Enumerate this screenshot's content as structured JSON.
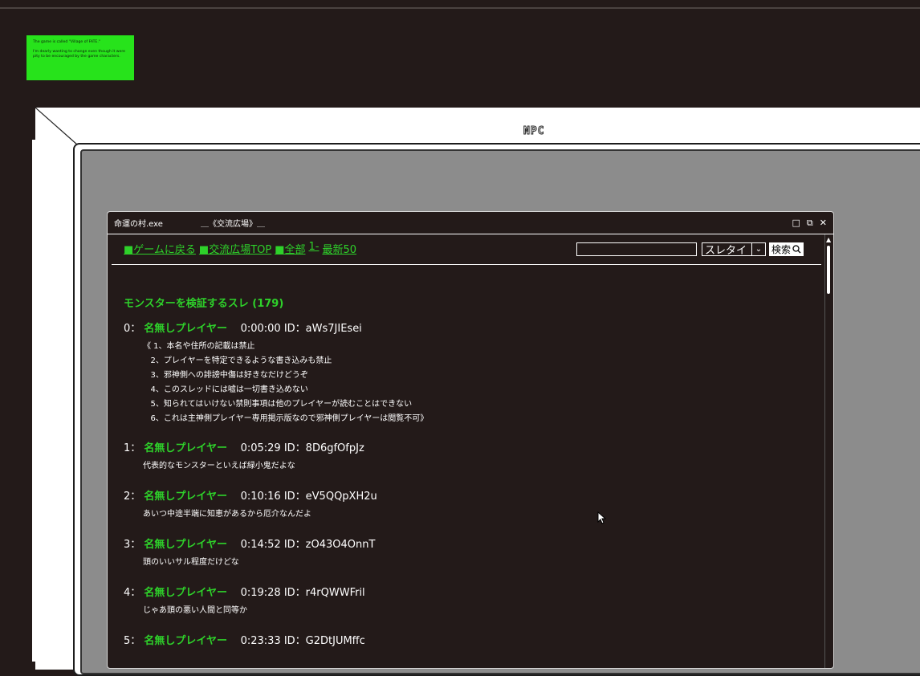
{
  "sticky_note": {
    "line1": "The game is called \"Village of FATE.\"",
    "line2": "I'm dearly wanting to change even though it were pity to be encouraged by the game characters."
  },
  "frame_label": "NPC",
  "window": {
    "app_name": "命運の村.exe",
    "title": "＿《交流広場》＿",
    "buttons": {
      "minimize": "□",
      "restore": "⧉",
      "close": "✕"
    }
  },
  "nav": {
    "back": "■ゲームに戻る",
    "top": "■交流広場TOP",
    "all": "■全部",
    "from1": "1-",
    "latest": "最新50"
  },
  "search": {
    "value": "",
    "select_value": "スレタイ",
    "button": "検索"
  },
  "thread": {
    "title": "モンスターを検証するスレ (179)",
    "posts": [
      {
        "num": "0：",
        "name": "名無しプレイヤー",
        "meta": "0:00:00 ID：aWs7JIEsei",
        "body": "《 1、本名や住所の記載は禁止\n   2、プレイヤーを特定できるような書き込みも禁止\n   3、邪神側への誹謗中傷は好きなだけどうぞ\n   4、このスレッドには嘘は一切書き込めない\n   5、知られてはいけない禁則事項は他のプレイヤーが読むことはできない\n   6、これは主神側プレイヤー専用掲示版なので邪神側プレイヤーは閲覧不可》"
      },
      {
        "num": "1：",
        "name": "名無しプレイヤー",
        "meta": "0:05:29 ID：8D6gfOfpJz",
        "body": "代表的なモンスターといえば緑小鬼だよな"
      },
      {
        "num": "2：",
        "name": "名無しプレイヤー",
        "meta": "0:10:16 ID：eV5QQpXH2u",
        "body": "あいつ中途半端に知恵があるから厄介なんだよ"
      },
      {
        "num": "3：",
        "name": "名無しプレイヤー",
        "meta": "0:14:52 ID：zO43O4OnnT",
        "body": "頭のいいサル程度だけどな"
      },
      {
        "num": "4：",
        "name": "名無しプレイヤー",
        "meta": "0:19:28 ID：r4rQWWFril",
        "body": "じゃあ頭の悪い人間と同等か"
      },
      {
        "num": "5：",
        "name": "名無しプレイヤー",
        "meta": "0:23:33 ID：G2DtJUMffc",
        "body": ""
      }
    ]
  }
}
